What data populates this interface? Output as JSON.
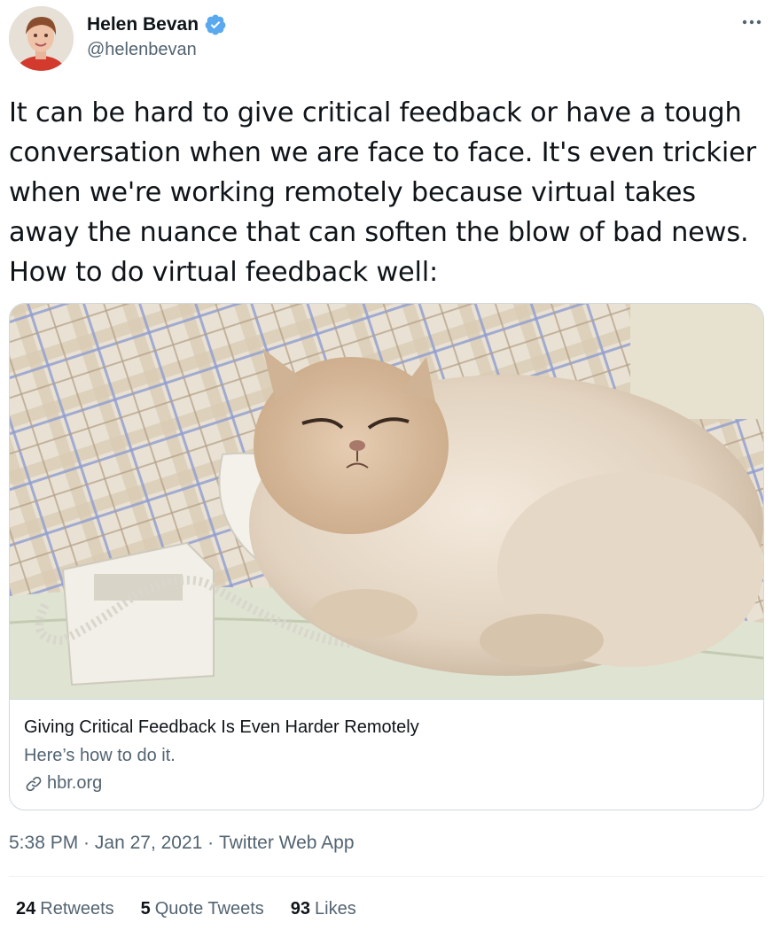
{
  "author": {
    "display_name": "Helen Bevan",
    "handle": "@helenbevan",
    "verified": true,
    "avatar_icon": "avatar-photo",
    "verified_color": "#1d9bf0"
  },
  "tweet": {
    "text": "It can be hard to give critical feedback or have a tough\nconversation when we are face to face. It's even trickier\nwhen we're working remotely because virtual takes\naway the nuance that can soften the blow of bad news.\nHow to do virtual feedback well:"
  },
  "card": {
    "image_icon": "persian-cat-with-phone-photo",
    "title": "Giving Critical Feedback Is Even Harder Remotely",
    "description": "Here’s how to do it.",
    "domain": "hbr.org",
    "link_icon": "link-icon"
  },
  "meta": {
    "time": "5:38 PM",
    "separator1": " · ",
    "date": "Jan 27, 2021",
    "separator2": " · ",
    "source": "Twitter Web App"
  },
  "stats": {
    "retweets_count": "24",
    "retweets_label": "Retweets",
    "quotes_count": "5",
    "quotes_label": "Quote Tweets",
    "likes_count": "93",
    "likes_label": "Likes"
  },
  "colors": {
    "text_primary": "#0f1419",
    "text_secondary": "#536471",
    "border": "#cfd9de",
    "accent": "#1d9bf0"
  }
}
